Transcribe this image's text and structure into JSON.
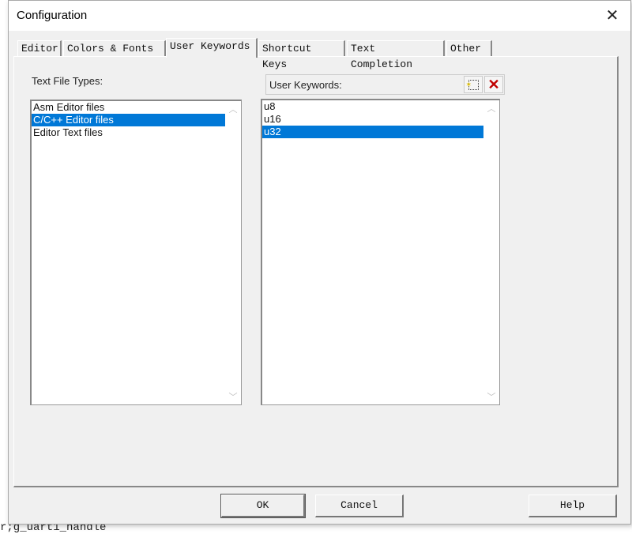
{
  "background": {
    "code_bottom": "r;g_uart1_handle"
  },
  "dialog": {
    "title": "Configuration"
  },
  "tabs": [
    {
      "label": "Editor"
    },
    {
      "label": "Colors & Fonts"
    },
    {
      "label": "User Keywords",
      "active": true
    },
    {
      "label": "Shortcut Keys"
    },
    {
      "label": "Text Completion"
    },
    {
      "label": "Other"
    }
  ],
  "file_types": {
    "label": "Text File Types:",
    "items": [
      "Asm Editor files",
      "C/C++ Editor files",
      "Editor Text files"
    ],
    "selected": "C/C++ Editor files"
  },
  "keywords": {
    "label": "User Keywords:",
    "items": [
      "u8",
      "u16",
      "u32"
    ],
    "selected": "u32",
    "new_icon": "new-item-icon",
    "delete_icon": "delete-x-icon"
  },
  "buttons": {
    "ok": "OK",
    "cancel": "Cancel",
    "help": "Help"
  },
  "colors": {
    "selection": "#0078d7",
    "delete": "#c00000"
  }
}
